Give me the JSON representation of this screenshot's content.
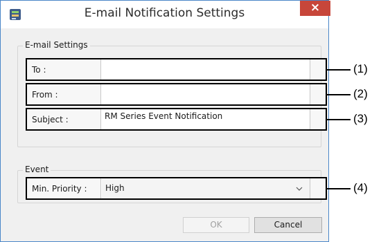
{
  "window": {
    "title": "E-mail Notification Settings",
    "close_label": "×"
  },
  "email_settings": {
    "group_label": "E-mail Settings",
    "to": {
      "label": "To :",
      "value": ""
    },
    "from": {
      "label": "From :",
      "value": ""
    },
    "subject": {
      "label": "Subject :",
      "value": "RM Series Event Notification"
    }
  },
  "event": {
    "group_label": "Event",
    "min_priority": {
      "label": "Min. Priority :",
      "value": "High"
    }
  },
  "buttons": {
    "ok_label": "OK",
    "cancel_label": "Cancel"
  },
  "callouts": [
    "(1)",
    "(2)",
    "(3)",
    "(4)"
  ],
  "colors": {
    "close_button": "#c7463a",
    "highlight_border": "#000000"
  }
}
